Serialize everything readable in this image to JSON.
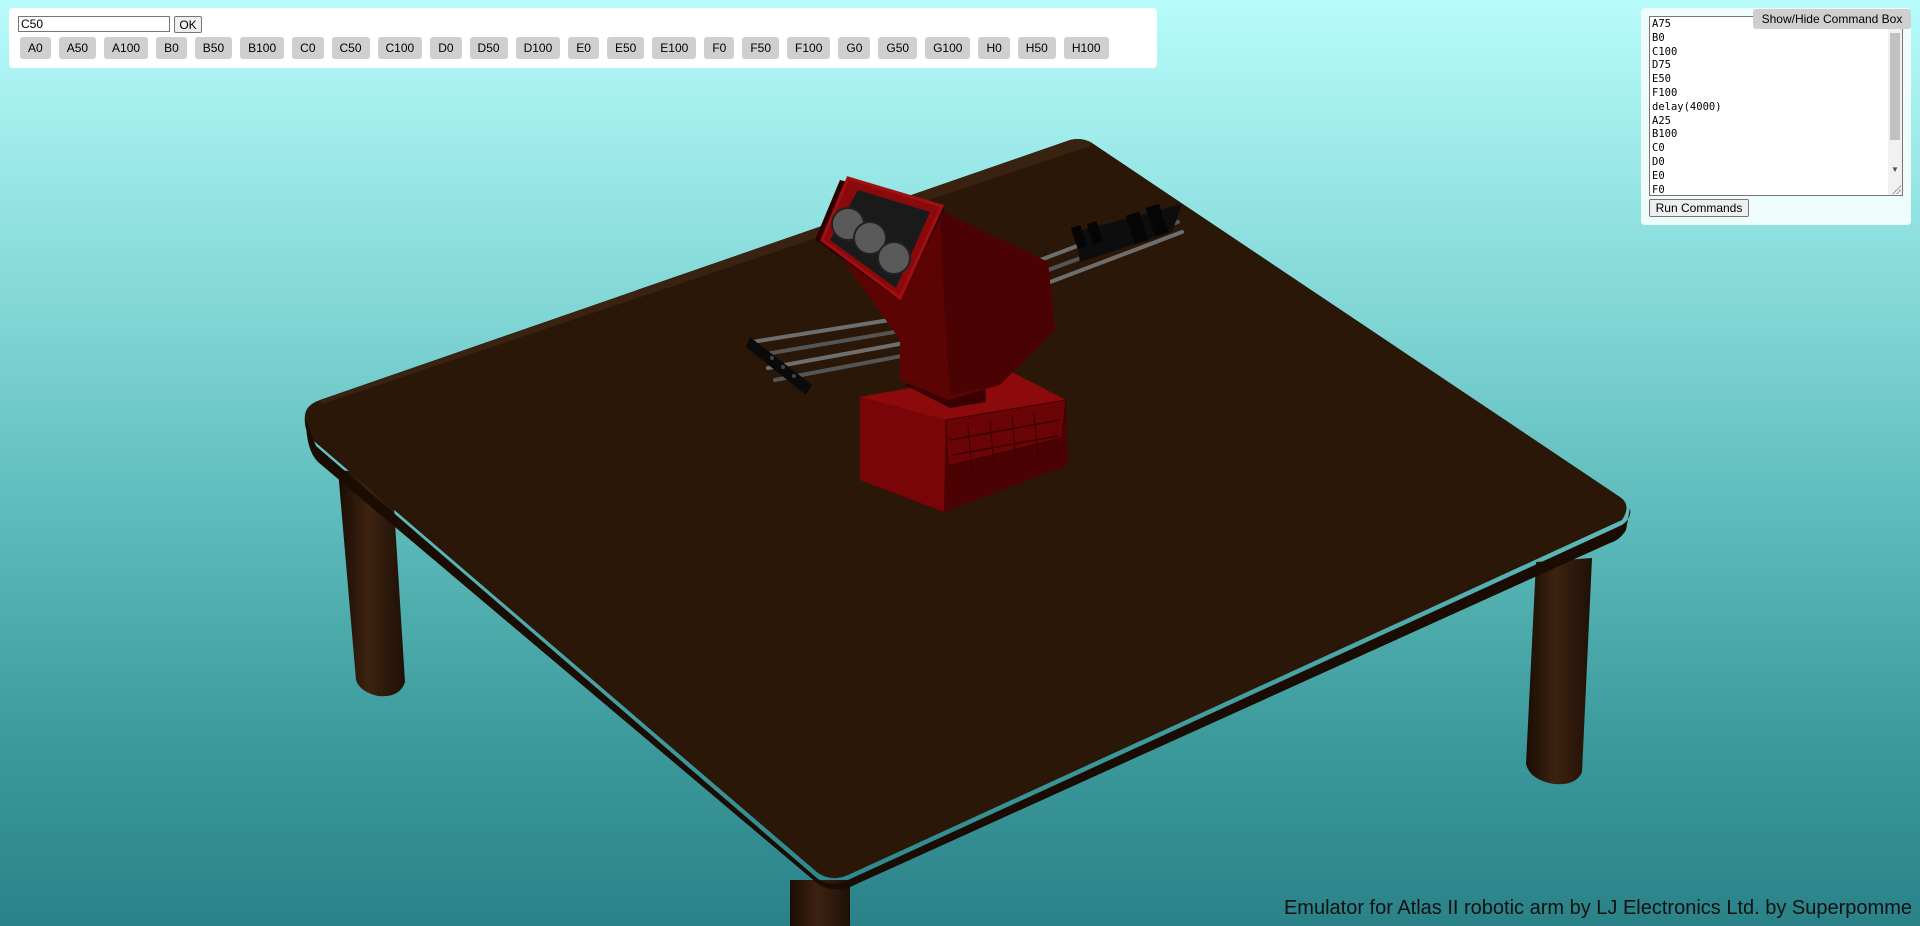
{
  "controls": {
    "command_value": "C50",
    "ok_label": "OK",
    "presets": [
      "A0",
      "A50",
      "A100",
      "B0",
      "B50",
      "B100",
      "C0",
      "C50",
      "C100",
      "D0",
      "D50",
      "D100",
      "E0",
      "E50",
      "E100",
      "F0",
      "F50",
      "F100",
      "G0",
      "G50",
      "G100",
      "H0",
      "H50",
      "H100"
    ]
  },
  "command_box": {
    "toggle_label": "Show/Hide Command Box",
    "lines": [
      "A75",
      "B0",
      "C100",
      "D75",
      "E50",
      "F100",
      "delay(4000)",
      "A25",
      "B100",
      "C0",
      "D0",
      "E0",
      "F0"
    ],
    "run_label": "Run Commands"
  },
  "footer": {
    "credit": "Emulator for Atlas II robotic arm by LJ Electronics Ltd. by Superpomme"
  },
  "colors": {
    "sky_top": "#b8fbfb",
    "sky_bottom": "#2a8288",
    "table": "#2b180a",
    "robot": "#6e0406"
  }
}
